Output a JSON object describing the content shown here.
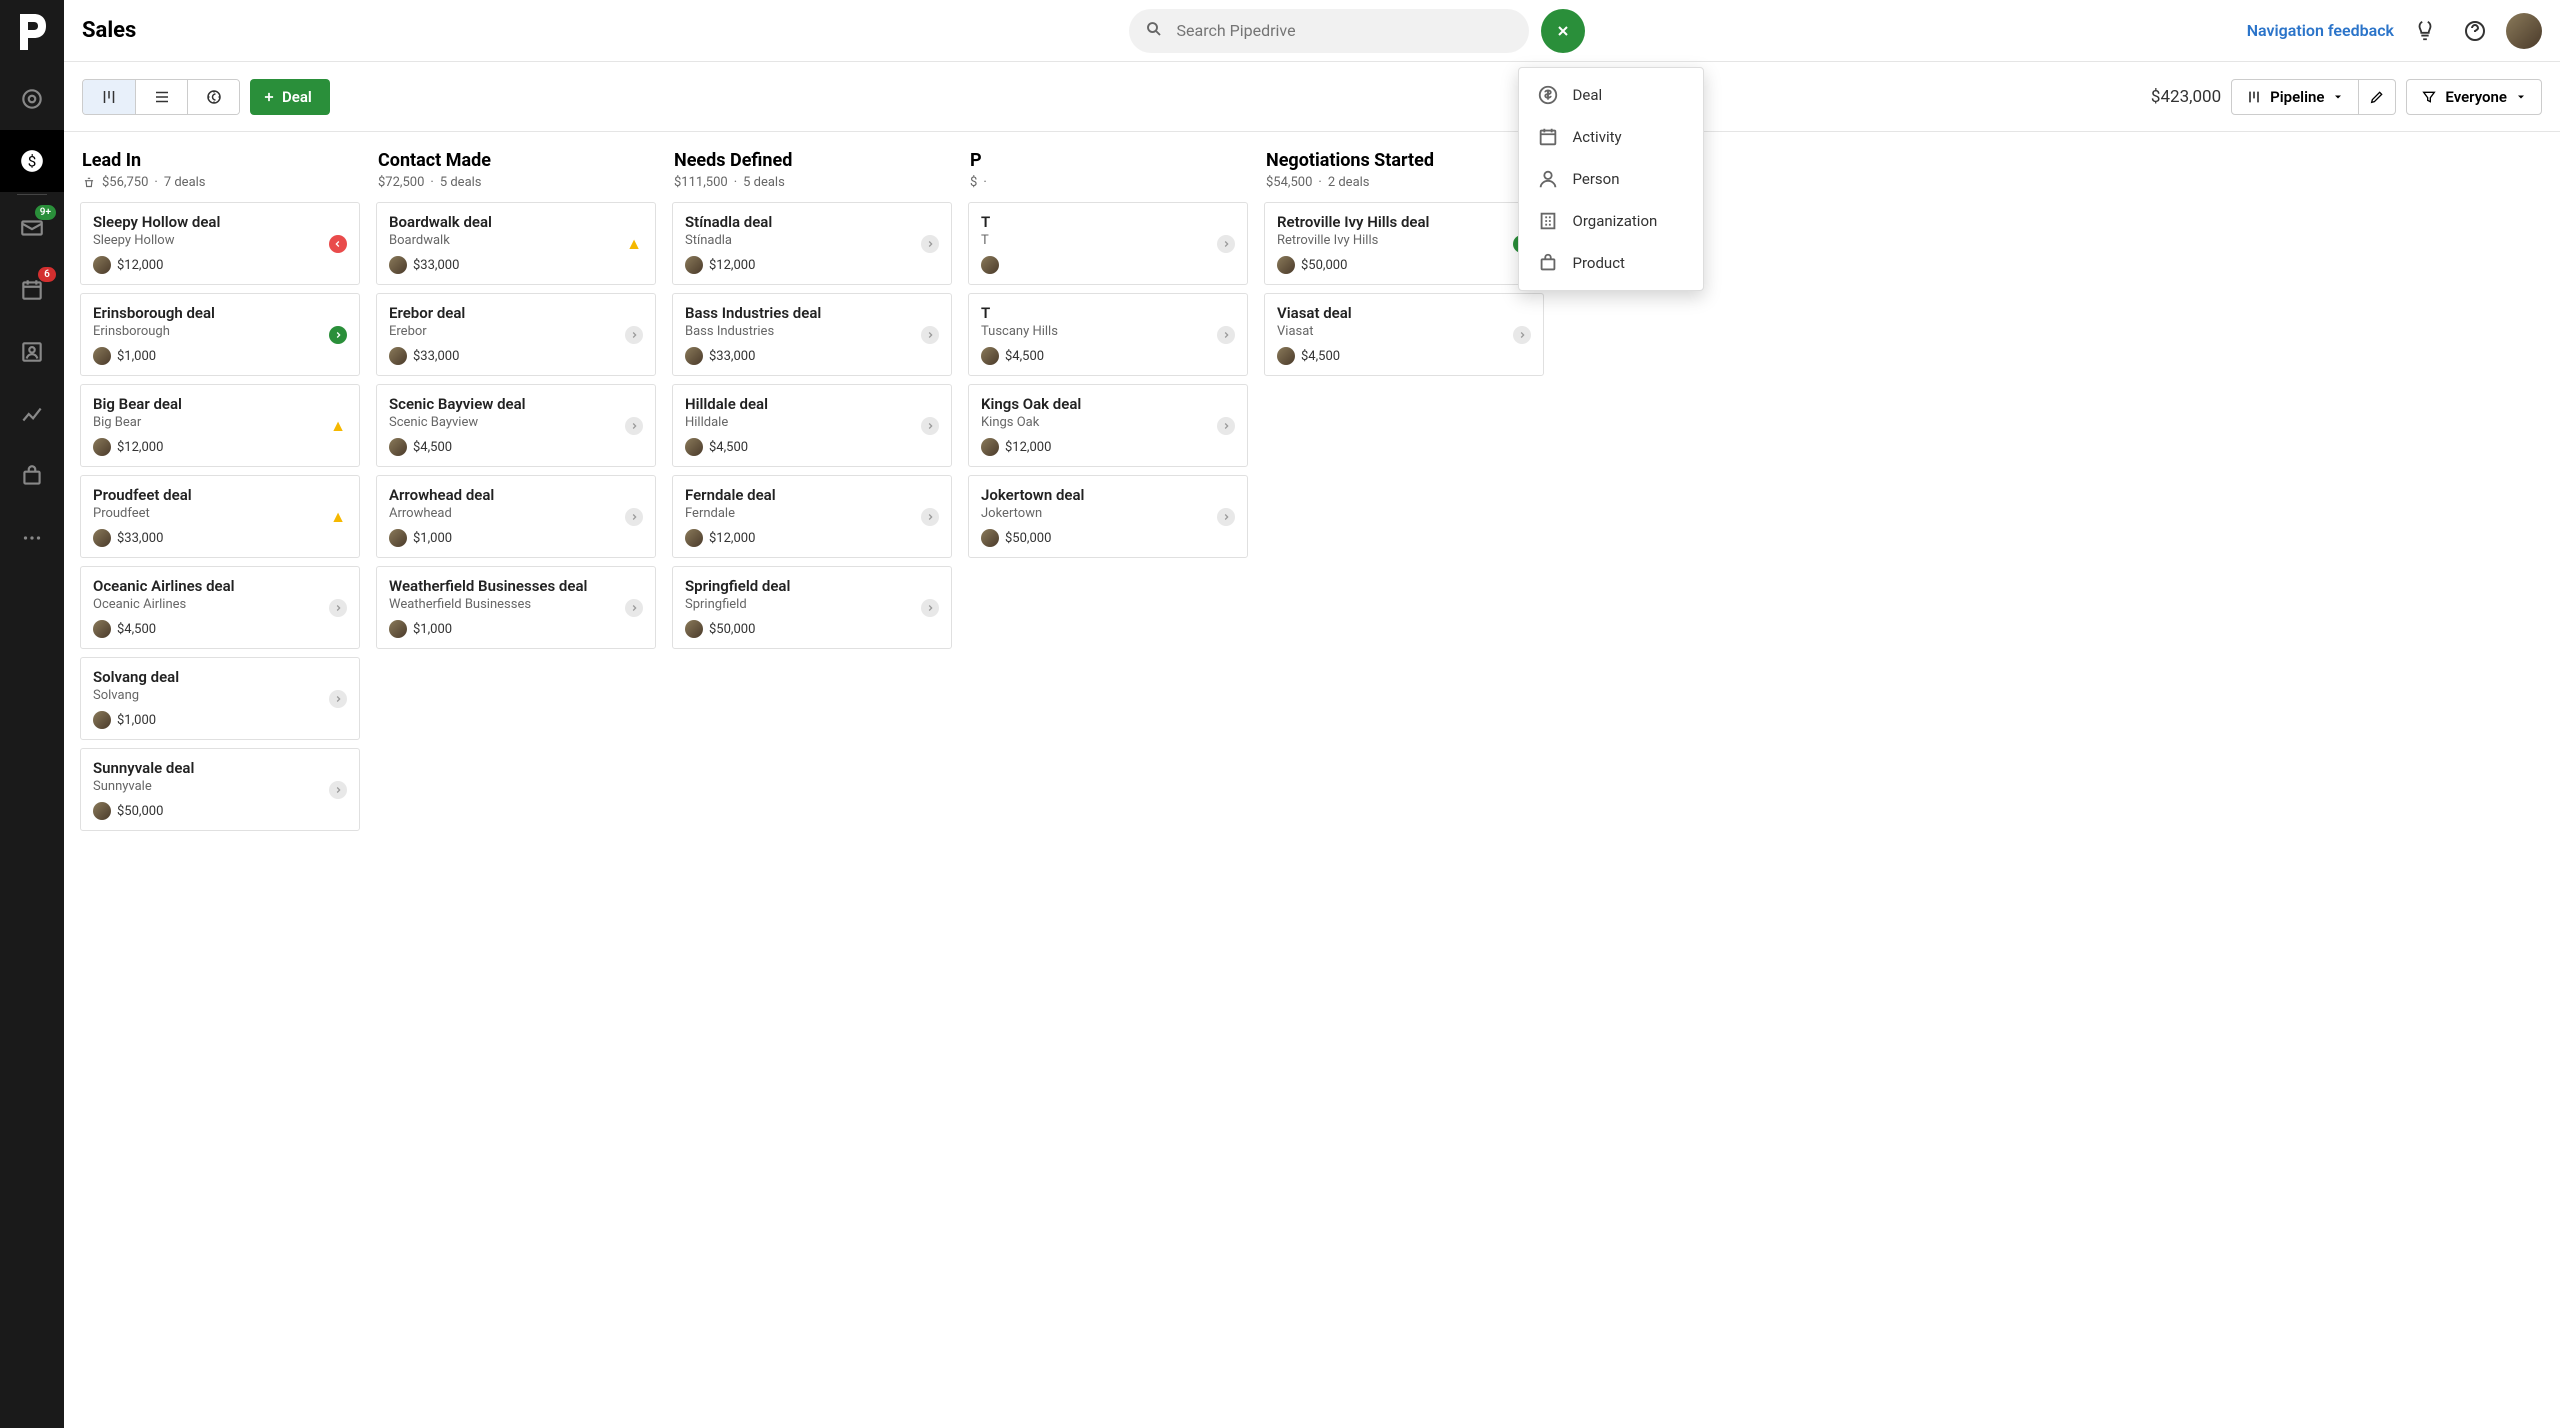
{
  "header": {
    "title": "Sales",
    "search_placeholder": "Search Pipedrive",
    "nav_feedback": "Navigation feedback"
  },
  "dropdown": {
    "items": [
      {
        "icon": "deal",
        "label": "Deal"
      },
      {
        "icon": "activity",
        "label": "Activity"
      },
      {
        "icon": "person",
        "label": "Person"
      },
      {
        "icon": "organization",
        "label": "Organization"
      },
      {
        "icon": "product",
        "label": "Product"
      }
    ]
  },
  "toolbar": {
    "deal_label": "Deal",
    "total": "$423,000",
    "pipeline_label": "Pipeline",
    "everyone_label": "Everyone"
  },
  "nav_badges": {
    "mail": "9+",
    "activities": "6"
  },
  "columns": [
    {
      "title": "Lead In",
      "amount": "$56,750",
      "deals": "7 deals",
      "show_rot_icon": true,
      "cards": [
        {
          "title": "Sleepy Hollow deal",
          "org": "Sleepy Hollow",
          "amount": "$12,000",
          "status": "red"
        },
        {
          "title": "Erinsborough deal",
          "org": "Erinsborough",
          "amount": "$1,000",
          "status": "green"
        },
        {
          "title": "Big Bear deal",
          "org": "Big Bear",
          "amount": "$12,000",
          "status": "warn"
        },
        {
          "title": "Proudfeet deal",
          "org": "Proudfeet",
          "amount": "$33,000",
          "status": "warn"
        },
        {
          "title": "Oceanic Airlines deal",
          "org": "Oceanic Airlines",
          "amount": "$4,500",
          "status": "neutral"
        },
        {
          "title": "Solvang deal",
          "org": "Solvang",
          "amount": "$1,000",
          "status": "neutral"
        },
        {
          "title": "Sunnyvale deal",
          "org": "Sunnyvale",
          "amount": "$50,000",
          "status": "neutral"
        }
      ]
    },
    {
      "title": "Contact Made",
      "amount": "$72,500",
      "deals": "5 deals",
      "cards": [
        {
          "title": "Boardwalk deal",
          "org": "Boardwalk",
          "amount": "$33,000",
          "status": "warn"
        },
        {
          "title": "Erebor deal",
          "org": "Erebor",
          "amount": "$33,000",
          "status": "neutral"
        },
        {
          "title": "Scenic Bayview deal",
          "org": "Scenic Bayview",
          "amount": "$4,500",
          "status": "neutral"
        },
        {
          "title": "Arrowhead deal",
          "org": "Arrowhead",
          "amount": "$1,000",
          "status": "neutral"
        },
        {
          "title": "Weatherfield Businesses deal",
          "org": "Weatherfield Businesses",
          "amount": "$1,000",
          "status": "neutral"
        }
      ]
    },
    {
      "title": "Needs Defined",
      "amount": "$111,500",
      "deals": "5 deals",
      "cards": [
        {
          "title": "Stínadla deal",
          "org": "Stínadla",
          "amount": "$12,000",
          "status": "neutral"
        },
        {
          "title": "Bass Industries deal",
          "org": "Bass Industries",
          "amount": "$33,000",
          "status": "neutral"
        },
        {
          "title": "Hilldale deal",
          "org": "Hilldale",
          "amount": "$4,500",
          "status": "neutral"
        },
        {
          "title": "Ferndale deal",
          "org": "Ferndale",
          "amount": "$12,000",
          "status": "neutral"
        },
        {
          "title": "Springfield deal",
          "org": "Springfield",
          "amount": "$50,000",
          "status": "neutral"
        }
      ]
    },
    {
      "title": "P",
      "amount": "$",
      "deals": "",
      "cards": [
        {
          "title": "T",
          "org": "T",
          "amount": "",
          "status": "neutral"
        },
        {
          "title": "T",
          "org": "Tuscany Hills",
          "amount": "$4,500",
          "status": "neutral"
        },
        {
          "title": "Kings Oak deal",
          "org": "Kings Oak",
          "amount": "$12,000",
          "status": "neutral"
        },
        {
          "title": "Jokertown deal",
          "org": "Jokertown",
          "amount": "$50,000",
          "status": "neutral"
        }
      ]
    },
    {
      "title": "Negotiations Started",
      "amount": "$54,500",
      "deals": "2 deals",
      "cards": [
        {
          "title": "Retroville Ivy Hills deal",
          "org": "Retroville Ivy Hills",
          "amount": "$50,000",
          "status": "green"
        },
        {
          "title": "Viasat deal",
          "org": "Viasat",
          "amount": "$4,500",
          "status": "neutral"
        }
      ]
    }
  ]
}
